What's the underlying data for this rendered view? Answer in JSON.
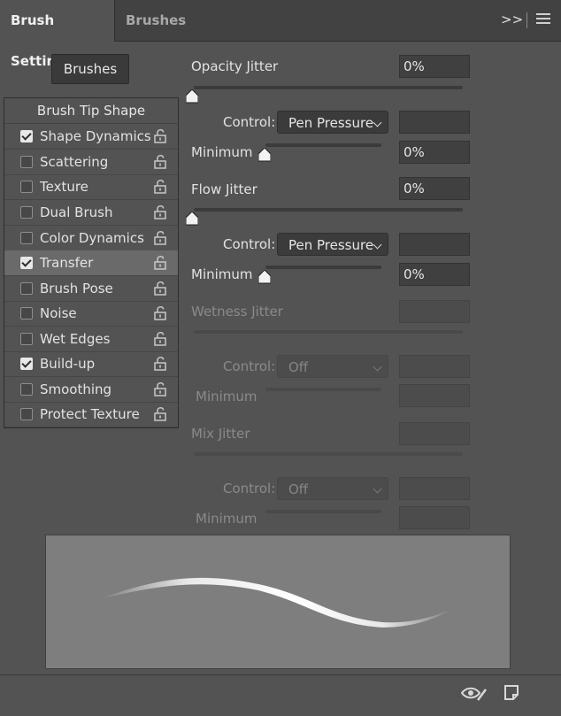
{
  "tabs": {
    "active": "Brush Settings",
    "inactive": "Brushes"
  },
  "header_icons": {
    "expand": ">>",
    "menu": "hamburger-menu-icon"
  },
  "brushes_button": "Brushes",
  "sidebar": {
    "heading": "Brush Tip Shape",
    "items": [
      {
        "label": "Shape Dynamics",
        "checked": true,
        "selected": false
      },
      {
        "label": "Scattering",
        "checked": false,
        "selected": false
      },
      {
        "label": "Texture",
        "checked": false,
        "selected": false
      },
      {
        "label": "Dual Brush",
        "checked": false,
        "selected": false
      },
      {
        "label": "Color Dynamics",
        "checked": false,
        "selected": false
      },
      {
        "label": "Transfer",
        "checked": true,
        "selected": true
      },
      {
        "label": "Brush Pose",
        "checked": false,
        "selected": false
      },
      {
        "label": "Noise",
        "checked": false,
        "selected": false
      },
      {
        "label": "Wet Edges",
        "checked": false,
        "selected": false
      },
      {
        "label": "Build-up",
        "checked": true,
        "selected": false
      },
      {
        "label": "Smoothing",
        "checked": false,
        "selected": false
      },
      {
        "label": "Protect Texture",
        "checked": false,
        "selected": false
      }
    ]
  },
  "transfer": {
    "opacity_jitter": {
      "label": "Opacity Jitter",
      "value": "0%",
      "slider_fraction": 0.0
    },
    "opacity_control": {
      "label": "Control:",
      "value": "Pen Pressure"
    },
    "opacity_minimum": {
      "label": "Minimum",
      "value": "0%",
      "slider_fraction": 0.0
    },
    "flow_jitter": {
      "label": "Flow Jitter",
      "value": "0%",
      "slider_fraction": 0.0
    },
    "flow_control": {
      "label": "Control:",
      "value": "Pen Pressure"
    },
    "flow_minimum": {
      "label": "Minimum",
      "value": "0%",
      "slider_fraction": 0.0
    },
    "wetness_jitter": {
      "label": "Wetness Jitter",
      "value": ""
    },
    "wetness_control": {
      "label": "Control:",
      "value": "Off"
    },
    "wetness_minimum": {
      "label": "Minimum",
      "value": ""
    },
    "mix_jitter": {
      "label": "Mix Jitter",
      "value": ""
    },
    "mix_control": {
      "label": "Control:",
      "value": "Off"
    },
    "mix_minimum": {
      "label": "Minimum",
      "value": ""
    }
  },
  "footer_icons": [
    "eye-brush-icon",
    "new-preset-icon"
  ]
}
